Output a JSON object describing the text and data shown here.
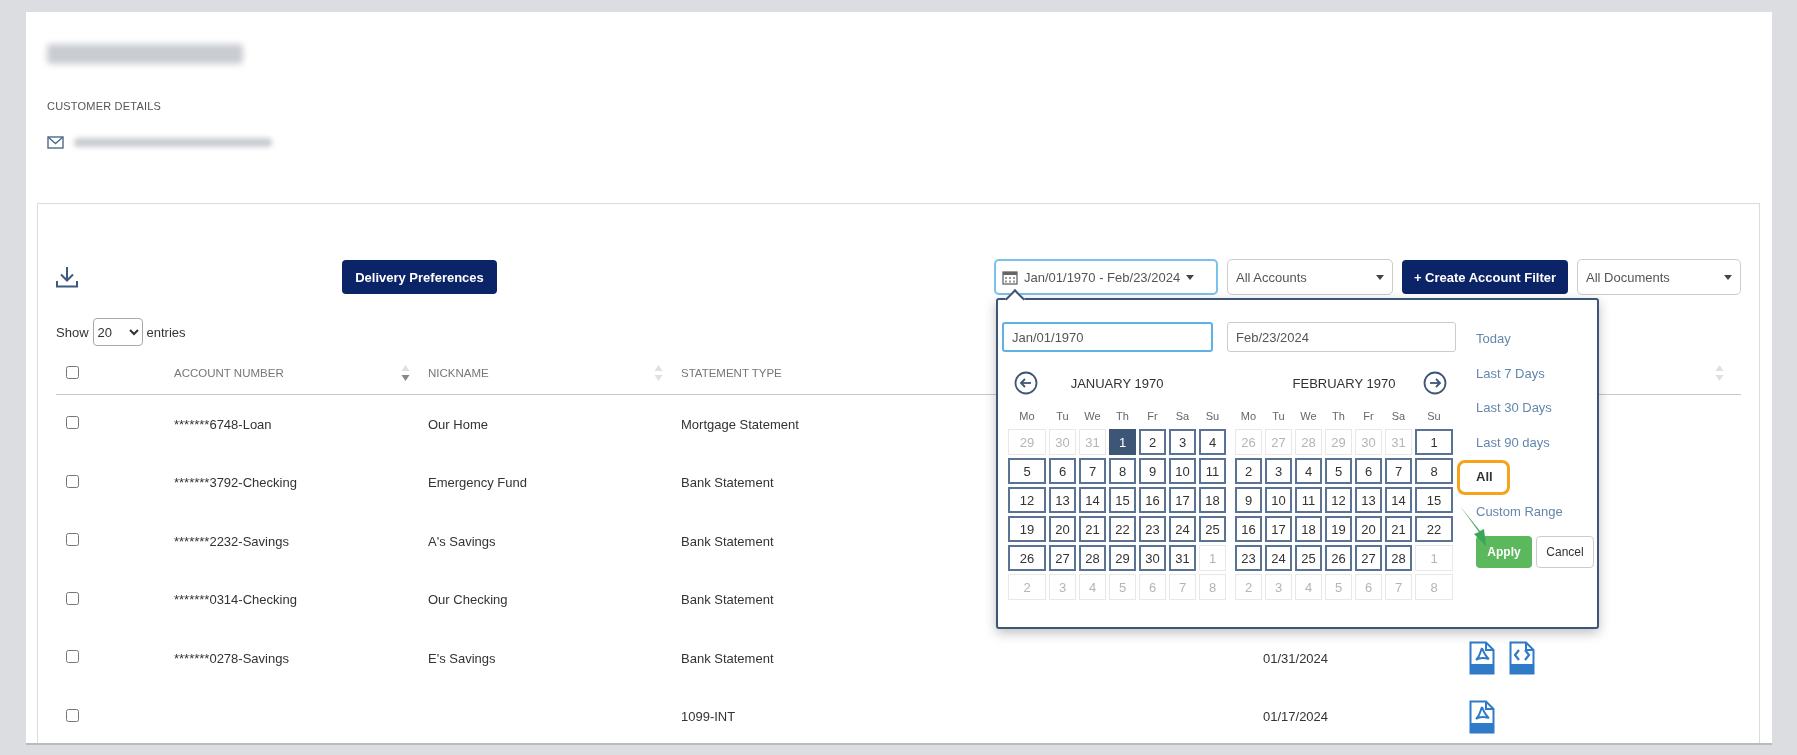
{
  "customer": {
    "section_label": "CUSTOMER DETAILS"
  },
  "toolbar": {
    "delivery_button": "Delivery Preferences",
    "date_range": "Jan/01/1970 - Feb/23/2024",
    "accounts_select": "All Accounts",
    "create_filter_button": "+ Create Account Filter",
    "documents_select": "All Documents"
  },
  "entries": {
    "before": "Show",
    "value": "20",
    "after": "entries"
  },
  "table": {
    "select_all_checked": false,
    "columns": [
      {
        "label": "ACCOUNT NUMBER",
        "kind": "descending"
      },
      {
        "label": "NICKNAME",
        "kind": "unsorted"
      },
      {
        "label": "STATEMENT TYPE"
      }
    ],
    "column_6": {
      "kind": "unsorted"
    },
    "rows": [
      {
        "checked": false,
        "account": "*******6748-Loan",
        "nickname": "Our Home",
        "statement_type": "Mortgage Statement"
      },
      {
        "checked": false,
        "account": "*******3792-Checking",
        "nickname": "Emergency Fund",
        "statement_type": "Bank Statement"
      },
      {
        "checked": false,
        "account": "*******2232-Savings",
        "nickname": "A's Savings",
        "statement_type": "Bank Statement"
      },
      {
        "checked": false,
        "account": "*******0314-Checking",
        "nickname": "Our Checking",
        "statement_type": "Bank Statement"
      },
      {
        "checked": false,
        "account": "*******0278-Savings",
        "nickname": "E's Savings",
        "statement_type": "Bank Statement",
        "date": "01/31/2024",
        "documents": [
          {
            "kind": "pdf"
          },
          {
            "kind": "html"
          }
        ]
      },
      {
        "checked": false,
        "statement_type": "1099-INT",
        "date": "01/17/2024",
        "documents": [
          {
            "kind": "pdf"
          }
        ]
      }
    ]
  },
  "datepicker": {
    "start_date": "Jan/01/1970",
    "end_date": "Feb/23/2024",
    "months": [
      {
        "title": "JANUARY 1970",
        "kind": "previous",
        "weekdays": [
          "Mo",
          "Tu",
          "We",
          "Th",
          "Fr",
          "Sa",
          "Su"
        ],
        "weeks": [
          [
            {
              "d": "29",
              "muted": true,
              "selected": false
            },
            {
              "d": "30",
              "muted": true,
              "selected": false
            },
            {
              "d": "31",
              "muted": true,
              "selected": false
            },
            {
              "d": "1",
              "muted": false,
              "selected": true
            },
            {
              "d": "2",
              "muted": false,
              "selected": false
            },
            {
              "d": "3",
              "muted": false,
              "selected": false
            },
            {
              "d": "4",
              "muted": false,
              "selected": false
            }
          ],
          [
            {
              "d": "5",
              "muted": false,
              "selected": false
            },
            {
              "d": "6",
              "muted": false,
              "selected": false
            },
            {
              "d": "7",
              "muted": false,
              "selected": false
            },
            {
              "d": "8",
              "muted": false,
              "selected": false
            },
            {
              "d": "9",
              "muted": false,
              "selected": false
            },
            {
              "d": "10",
              "muted": false,
              "selected": false
            },
            {
              "d": "11",
              "muted": false,
              "selected": false
            }
          ],
          [
            {
              "d": "12",
              "muted": false,
              "selected": false
            },
            {
              "d": "13",
              "muted": false,
              "selected": false
            },
            {
              "d": "14",
              "muted": false,
              "selected": false
            },
            {
              "d": "15",
              "muted": false,
              "selected": false
            },
            {
              "d": "16",
              "muted": false,
              "selected": false
            },
            {
              "d": "17",
              "muted": false,
              "selected": false
            },
            {
              "d": "18",
              "muted": false,
              "selected": false
            }
          ],
          [
            {
              "d": "19",
              "muted": false,
              "selected": false
            },
            {
              "d": "20",
              "muted": false,
              "selected": false
            },
            {
              "d": "21",
              "muted": false,
              "selected": false
            },
            {
              "d": "22",
              "muted": false,
              "selected": false
            },
            {
              "d": "23",
              "muted": false,
              "selected": false
            },
            {
              "d": "24",
              "muted": false,
              "selected": false
            },
            {
              "d": "25",
              "muted": false,
              "selected": false
            }
          ],
          [
            {
              "d": "26",
              "muted": false,
              "selected": false
            },
            {
              "d": "27",
              "muted": false,
              "selected": false
            },
            {
              "d": "28",
              "muted": false,
              "selected": false
            },
            {
              "d": "29",
              "muted": false,
              "selected": false
            },
            {
              "d": "30",
              "muted": false,
              "selected": false
            },
            {
              "d": "31",
              "muted": false,
              "selected": false
            },
            {
              "d": "1",
              "muted": true,
              "selected": false
            }
          ],
          [
            {
              "d": "2",
              "muted": true,
              "selected": false
            },
            {
              "d": "3",
              "muted": true,
              "selected": false
            },
            {
              "d": "4",
              "muted": true,
              "selected": false
            },
            {
              "d": "5",
              "muted": true,
              "selected": false
            },
            {
              "d": "6",
              "muted": true,
              "selected": false
            },
            {
              "d": "7",
              "muted": true,
              "selected": false
            },
            {
              "d": "8",
              "muted": true,
              "selected": false
            }
          ]
        ]
      },
      {
        "title": "FEBRUARY 1970",
        "kind": "next",
        "weekdays": [
          "Mo",
          "Tu",
          "We",
          "Th",
          "Fr",
          "Sa",
          "Su"
        ],
        "weeks": [
          [
            {
              "d": "26",
              "muted": true,
              "selected": false
            },
            {
              "d": "27",
              "muted": true,
              "selected": false
            },
            {
              "d": "28",
              "muted": true,
              "selected": false
            },
            {
              "d": "29",
              "muted": true,
              "selected": false
            },
            {
              "d": "30",
              "muted": true,
              "selected": false
            },
            {
              "d": "31",
              "muted": true,
              "selected": false
            },
            {
              "d": "1",
              "muted": false,
              "selected": false
            }
          ],
          [
            {
              "d": "2",
              "muted": false,
              "selected": false
            },
            {
              "d": "3",
              "muted": false,
              "selected": false
            },
            {
              "d": "4",
              "muted": false,
              "selected": false
            },
            {
              "d": "5",
              "muted": false,
              "selected": false
            },
            {
              "d": "6",
              "muted": false,
              "selected": false
            },
            {
              "d": "7",
              "muted": false,
              "selected": false
            },
            {
              "d": "8",
              "muted": false,
              "selected": false
            }
          ],
          [
            {
              "d": "9",
              "muted": false,
              "selected": false
            },
            {
              "d": "10",
              "muted": false,
              "selected": false
            },
            {
              "d": "11",
              "muted": false,
              "selected": false
            },
            {
              "d": "12",
              "muted": false,
              "selected": false
            },
            {
              "d": "13",
              "muted": false,
              "selected": false
            },
            {
              "d": "14",
              "muted": false,
              "selected": false
            },
            {
              "d": "15",
              "muted": false,
              "selected": false
            }
          ],
          [
            {
              "d": "16",
              "muted": false,
              "selected": false
            },
            {
              "d": "17",
              "muted": false,
              "selected": false
            },
            {
              "d": "18",
              "muted": false,
              "selected": false
            },
            {
              "d": "19",
              "muted": false,
              "selected": false
            },
            {
              "d": "20",
              "muted": false,
              "selected": false
            },
            {
              "d": "21",
              "muted": false,
              "selected": false
            },
            {
              "d": "22",
              "muted": false,
              "selected": false
            }
          ],
          [
            {
              "d": "23",
              "muted": false,
              "selected": false
            },
            {
              "d": "24",
              "muted": false,
              "selected": false
            },
            {
              "d": "25",
              "muted": false,
              "selected": false
            },
            {
              "d": "26",
              "muted": false,
              "selected": false
            },
            {
              "d": "27",
              "muted": false,
              "selected": false
            },
            {
              "d": "28",
              "muted": false,
              "selected": false
            },
            {
              "d": "1",
              "muted": true,
              "selected": false
            }
          ],
          [
            {
              "d": "2",
              "muted": true,
              "selected": false
            },
            {
              "d": "3",
              "muted": true,
              "selected": false
            },
            {
              "d": "4",
              "muted": true,
              "selected": false
            },
            {
              "d": "5",
              "muted": true,
              "selected": false
            },
            {
              "d": "6",
              "muted": true,
              "selected": false
            },
            {
              "d": "7",
              "muted": true,
              "selected": false
            },
            {
              "d": "8",
              "muted": true,
              "selected": false
            }
          ]
        ]
      }
    ],
    "ranges": [
      {
        "label": "Today",
        "selected": false,
        "highlighted": false
      },
      {
        "label": "Last 7 Days",
        "selected": false,
        "highlighted": false
      },
      {
        "label": "Last 30 Days",
        "selected": false,
        "highlighted": false
      },
      {
        "label": "Last 90 days",
        "selected": false,
        "highlighted": false
      },
      {
        "label": "All",
        "selected": true,
        "highlighted": true
      },
      {
        "label": "Custom Range",
        "selected": false,
        "highlighted": false
      }
    ],
    "apply": {
      "label": "Apply",
      "pointed_at": true
    },
    "cancel": "Cancel"
  }
}
